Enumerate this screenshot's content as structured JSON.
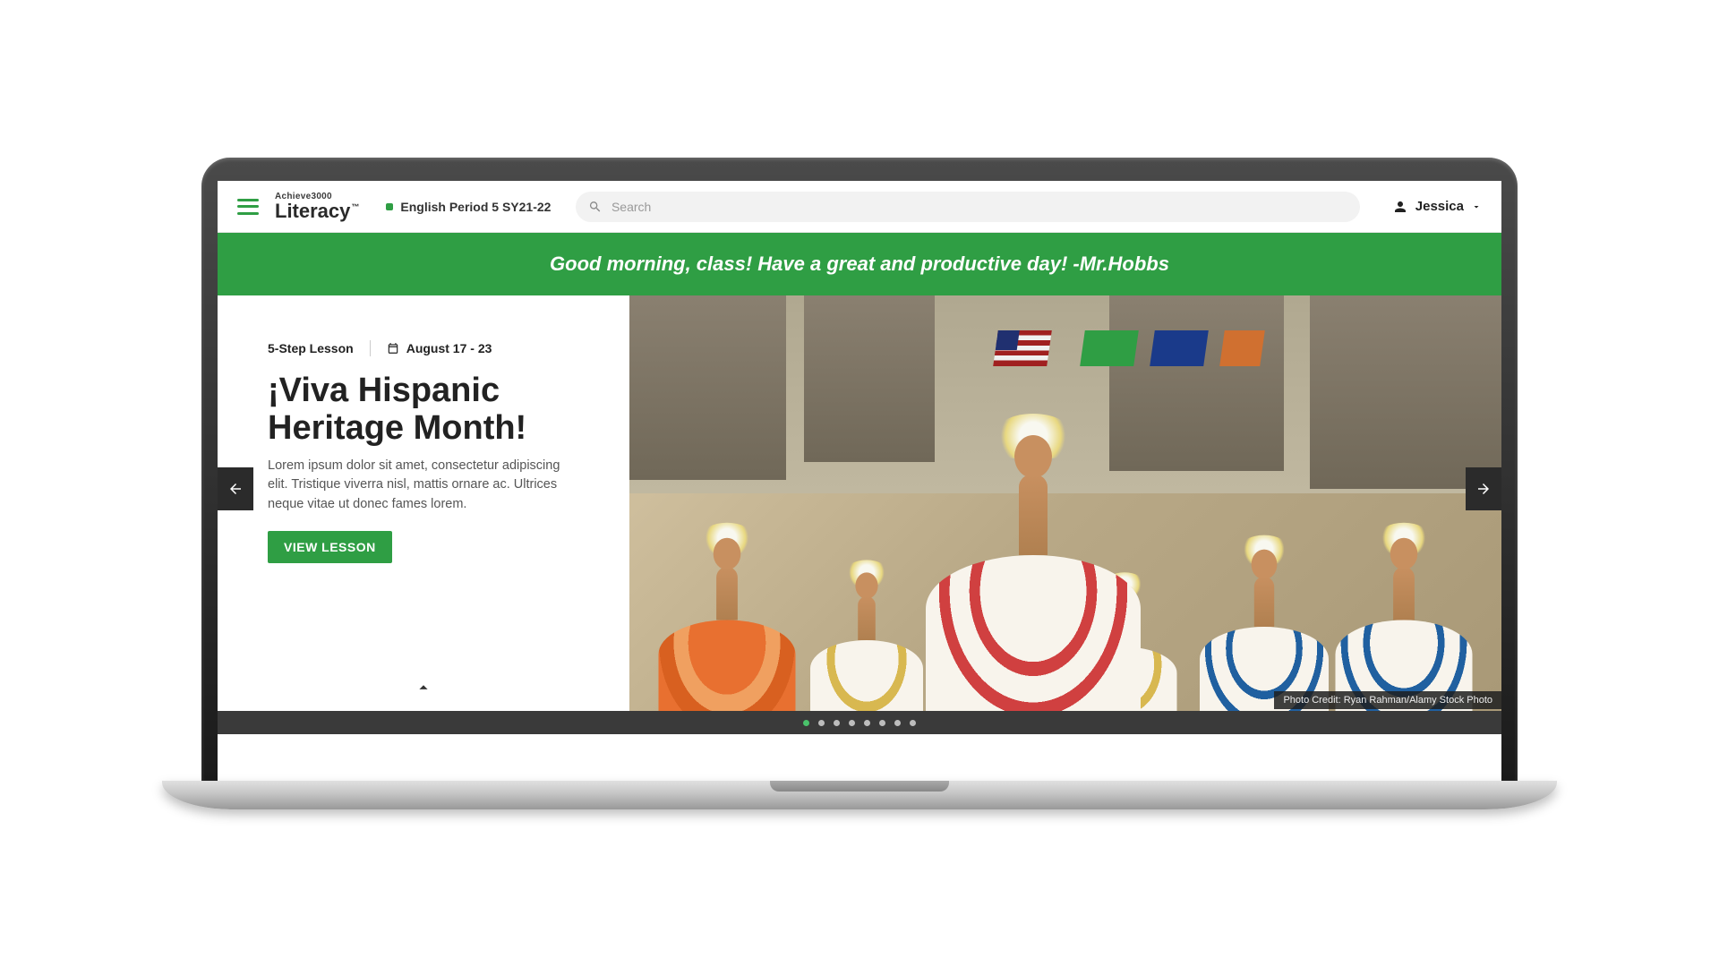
{
  "header": {
    "brand_top": "Achieve3000",
    "brand_bottom": "Literacy",
    "class_label": "English Period 5 SY21-22",
    "search_placeholder": "Search",
    "user_name": "Jessica"
  },
  "greeting_banner": "Good morning, class! Have a great and productive day! -Mr.Hobbs",
  "carousel": {
    "lesson_type": "5-Step Lesson",
    "date_range": "August 17 - 23",
    "title": "¡Viva Hispanic Heritage Month!",
    "description": "Lorem ipsum dolor sit amet, consectetur adipiscing elit. Tristique viverra nisl, mattis ornare ac. Ultrices neque vitae ut donec fames lorem.",
    "view_button": "VIEW LESSON",
    "photo_credit": "Photo Credit: Ryan Rahman/Alamy Stock Photo",
    "active_slide_index": 0,
    "total_slides": 8
  }
}
